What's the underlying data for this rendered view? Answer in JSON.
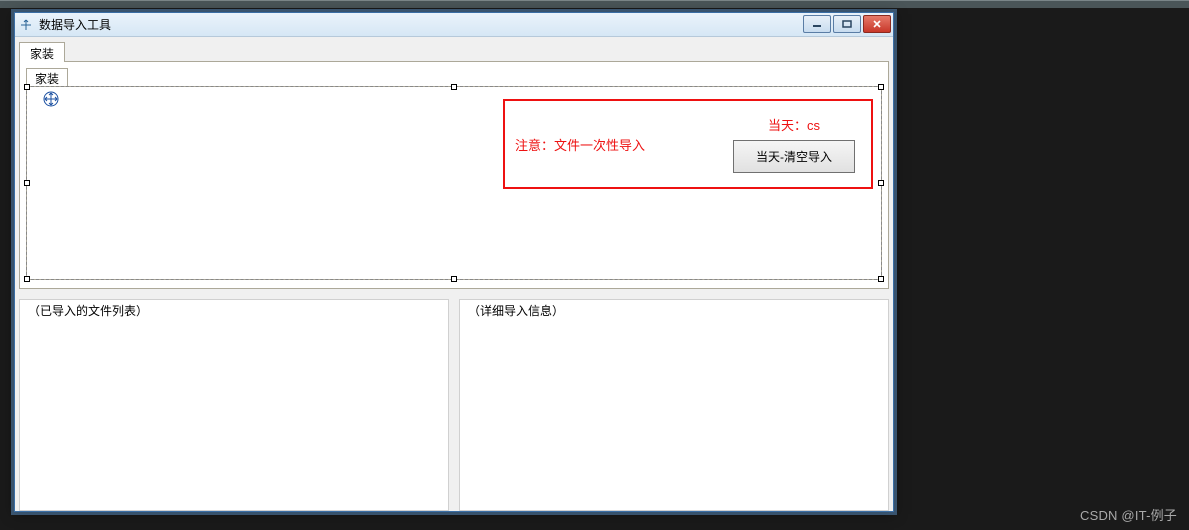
{
  "window": {
    "title": "数据导入工具"
  },
  "tabs": {
    "outer": {
      "label": "家装"
    },
    "inner": {
      "label": "家装"
    }
  },
  "red_panel": {
    "note": "注意：文件一次性导入",
    "day_label": "当天：cs",
    "button_label": "当天-清空导入"
  },
  "groups": {
    "imported_files": "（已导入的文件列表）",
    "detail_info": "（详细导入信息）"
  },
  "watermark": "CSDN @IT-例子"
}
